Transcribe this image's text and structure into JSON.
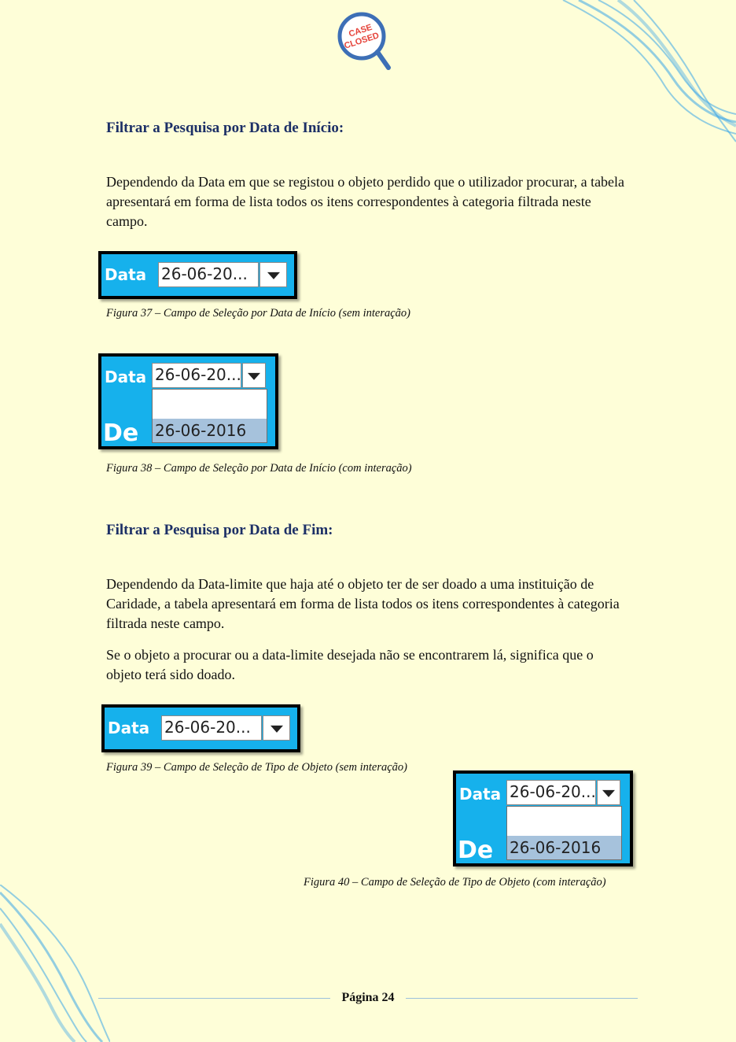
{
  "logo": {
    "line1": "CASE",
    "line2": "CLOSED",
    "icon": "magnifier-icon"
  },
  "section_start": {
    "heading": "Filtrar a Pesquisa por Data de Início:",
    "paragraph": "Dependendo da Data em que se registou o objeto perdido que o utilizador procurar, a tabela apresentará em forma de lista todos os itens correspondentes à categoria filtrada neste campo."
  },
  "fig37": {
    "label": "Data",
    "value": "26-06-20...",
    "caption": "Figura 37 – Campo de Seleção por Data de Início (sem interação)"
  },
  "fig38": {
    "label": "Data",
    "value": "26-06-20...",
    "option": "26-06-2016",
    "behind": "De",
    "caption": "Figura 38 – Campo de Seleção por Data de Início (com interação)"
  },
  "section_end": {
    "heading": "Filtrar a Pesquisa por Data de Fim:",
    "paragraph1": "Dependendo da Data-limite  que haja até o objeto ter de ser doado a uma instituição de Caridade, a tabela apresentará em forma de lista todos os itens correspondentes à categoria filtrada neste campo.",
    "paragraph2": "Se o objeto a procurar ou a data-limite desejada não se encontrarem lá, significa que o objeto terá sido doado."
  },
  "fig39": {
    "label": "Data",
    "value": "26-06-20...",
    "caption": "Figura 39 – Campo de Seleção de Tipo de Objeto (sem interação)"
  },
  "fig40": {
    "label": "Data",
    "value": "26-06-20...",
    "option": "26-06-2016",
    "behind": "De",
    "caption": "Figura 40 – Campo de Seleção de Tipo de Objeto (com interação)"
  },
  "footer": {
    "page": "Página 24"
  },
  "colors": {
    "background": "#fefed8",
    "heading": "#1c2f66",
    "widget_blue": "#16b1ec",
    "selected_option": "#a6c2dc",
    "logo_accent": "#e5433a"
  }
}
